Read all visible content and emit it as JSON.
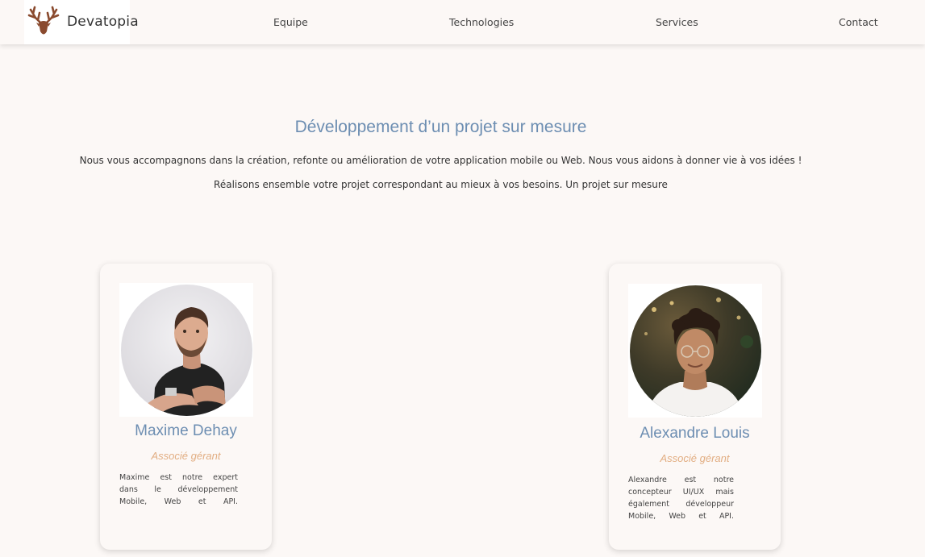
{
  "brand": {
    "name": "Devatopia",
    "icon": "deer-antlers-icon"
  },
  "nav": {
    "items": [
      {
        "label": "Equipe"
      },
      {
        "label": "Technologies"
      },
      {
        "label": "Services"
      },
      {
        "label": "Contact"
      }
    ]
  },
  "hero": {
    "title": "Développement d’un projet sur mesure",
    "paragraph_1": "Nous vous accompagnons dans la création, refonte ou amélioration de votre application mobile ou Web. Nous vous aidons à donner vie à vos idées !",
    "paragraph_2": "Réalisons ensemble votre projet correspondant au mieux à vos besoins. Un projet sur mesure"
  },
  "team": [
    {
      "name": "Maxime Dehay",
      "role": "Associé gérant",
      "description_lines": [
        "Maxime est notre expert",
        "dans le développement",
        "Mobile, Web et API."
      ]
    },
    {
      "name": "Alexandre Louis",
      "role": "Associé gérant",
      "description_lines": [
        "Alexandre est notre",
        "concepteur UI/UX mais",
        "également développeur",
        "Mobile, Web et API."
      ]
    }
  ],
  "colors": {
    "background": "#fcf8f6",
    "title": "#6d8eb2",
    "role": "#e2ae83",
    "logo": "#8a4a2e"
  }
}
